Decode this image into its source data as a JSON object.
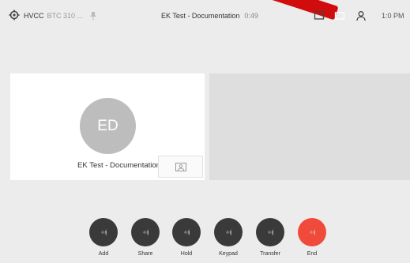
{
  "topbar": {
    "account": "HVCC",
    "account_sub": "BTC 310 ...",
    "call_title": "EK Test - Documentation",
    "call_timer": "0:49",
    "time": "1:0 PM"
  },
  "participants": [
    {
      "initials": "ED",
      "name": "EK Test - Documentation"
    }
  ],
  "controls": [
    {
      "glyph": "·ı·ıj",
      "label": "Add"
    },
    {
      "glyph": "·ı·ıj",
      "label": "Share"
    },
    {
      "glyph": "·ı·ıj",
      "label": "Hold"
    },
    {
      "glyph": "·ı·ıj",
      "label": "Keypad"
    },
    {
      "glyph": "·ı·ıj",
      "label": "Transfer"
    },
    {
      "glyph": "·ı·ıj",
      "label": "End"
    }
  ],
  "colors": {
    "background": "#ececec",
    "control_button": "#3a3a3a",
    "end_button": "#f04b3a",
    "avatar": "#bdbdbd",
    "record_indicator": "#d00000"
  },
  "icons": {
    "settings": "gear-icon",
    "pin": "pin-icon",
    "chat": "chat-icon",
    "record": "record-icon",
    "participants": "person-icon",
    "camera_off": "camera-off-icon"
  }
}
